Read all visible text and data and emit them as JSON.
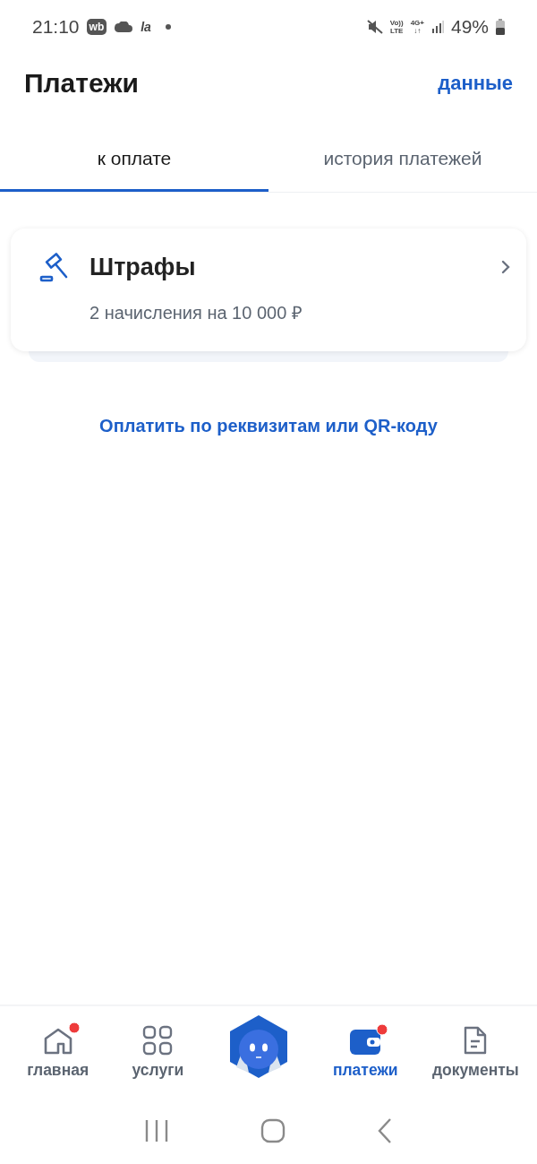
{
  "status_bar": {
    "time": "21:10",
    "app_badge": "wb",
    "app_text": "la",
    "volte": [
      "Vo))",
      "LTE"
    ],
    "network": "4G+",
    "network_arrows": "↓↑",
    "battery": "49%"
  },
  "header": {
    "title": "Платежи",
    "action": "данные"
  },
  "tabs": [
    {
      "label": "к оплате",
      "selected": true
    },
    {
      "label": "история платежей",
      "selected": false
    }
  ],
  "card": {
    "title": "Штрафы",
    "subtitle": "2 начисления на 10 000 ₽"
  },
  "link": "Оплатить по реквизитам или QR-коду",
  "bottom_nav": [
    {
      "kind": "home",
      "label": "главная",
      "selected": false,
      "badge": true
    },
    {
      "kind": "services",
      "label": "услуги",
      "selected": false,
      "badge": false
    },
    {
      "kind": "assistant"
    },
    {
      "kind": "payments",
      "label": "платежи",
      "selected": true,
      "badge": true
    },
    {
      "kind": "documents",
      "label": "документы",
      "selected": false,
      "badge": false
    }
  ]
}
